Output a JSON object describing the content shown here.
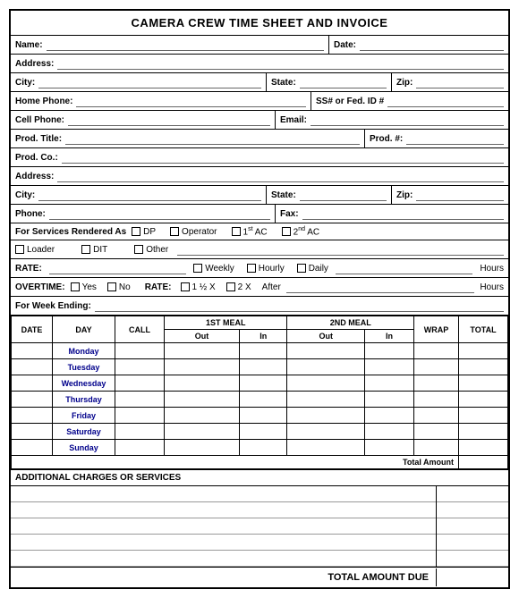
{
  "title": "CAMERA CREW TIME SHEET AND INVOICE",
  "fields": {
    "name_label": "Name:",
    "date_label": "Date:",
    "address_label": "Address:",
    "city_label": "City:",
    "state_label": "State:",
    "zip_label": "Zip:",
    "home_phone_label": "Home Phone:",
    "ss_label": "SS# or Fed. ID #",
    "cell_phone_label": "Cell Phone:",
    "email_label": "Email:",
    "prod_title_label": "Prod. Title:",
    "prod_no_label": "Prod. #:",
    "prod_co_label": "Prod. Co.:",
    "address2_label": "Address:",
    "city2_label": "City:",
    "state2_label": "State:",
    "zip2_label": "Zip:",
    "phone_label": "Phone:",
    "fax_label": "Fax:",
    "services_label": "For Services Rendered As",
    "dp_label": "DP",
    "operator_label": "Operator",
    "ac1_label": "1st AC",
    "ac2_label": "2nd AC",
    "loader_label": "Loader",
    "dit_label": "DIT",
    "other_label": "Other",
    "rate_label": "RATE:",
    "weekly_label": "Weekly",
    "hourly_label": "Hourly",
    "daily_label": "Daily",
    "hours_label": "Hours",
    "overtime_label": "OVERTIME:",
    "yes_label": "Yes",
    "no_label": "No",
    "rate2_label": "RATE:",
    "rate_1_5x": "1 ½ X",
    "rate_2x": "2 X",
    "after_label": "After",
    "hours2_label": "Hours",
    "week_ending_label": "For Week Ending:",
    "table": {
      "headers": {
        "date": "DATE",
        "day": "DAY",
        "call": "CALL",
        "meal1": "1ST MEAL",
        "meal1_out": "Out",
        "meal1_in": "In",
        "meal2": "2ND MEAL",
        "meal2_out": "Out",
        "meal2_in": "In",
        "wrap": "WRAP",
        "total": "TOTAL"
      },
      "days": [
        "Monday",
        "Tuesday",
        "Wednesday",
        "Thursday",
        "Friday",
        "Saturday",
        "Sunday"
      ],
      "total_amount_label": "Total Amount"
    },
    "additional_label": "ADDITIONAL CHARGES OR SERVICES",
    "total_due_label": "TOTAL AMOUNT DUE"
  }
}
